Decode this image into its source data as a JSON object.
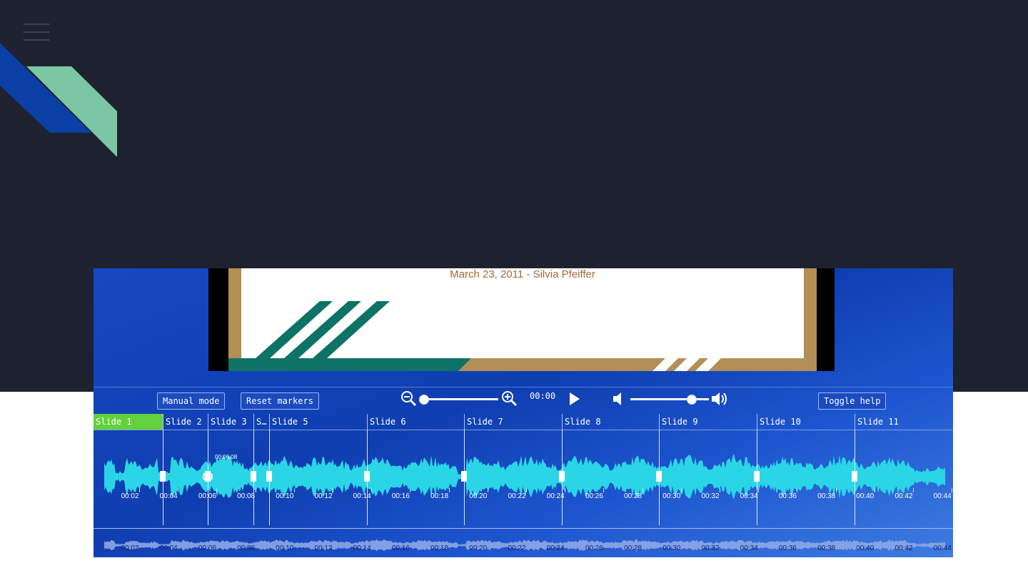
{
  "slide": {
    "caption": "March 23, 2011 - Silvia Pfeiffer"
  },
  "toolbar": {
    "manual_mode_label": "Manual mode",
    "reset_markers_label": "Reset markers",
    "time": "00:00",
    "toggle_help_label": "Toggle help",
    "zoom_level": 0.0,
    "volume_level": 0.77
  },
  "slides": [
    "Slide 1",
    "Slide 2",
    "Slide 3",
    "S…",
    "Slide 5",
    "Slide 6",
    "Slide 7",
    "Slide 8",
    "Slide 9",
    "Slide 10",
    "Slide 11"
  ],
  "ticks": [
    "00:02",
    "00:04",
    "00:06",
    "00:08",
    "00:10",
    "00:12",
    "00:14",
    "00:16",
    "00:18",
    "00:20",
    "00:22",
    "00:24",
    "00:26",
    "00:28",
    "00:30",
    "00:32",
    "00:34",
    "00:36",
    "00:38",
    "00:40",
    "00:42",
    "00:44"
  ],
  "cursor_time": "00:06.08",
  "colors": {
    "waveform": "#2ad6e6",
    "active_slide": "#63d13c",
    "mini_waveform": "#8fa6e6"
  }
}
